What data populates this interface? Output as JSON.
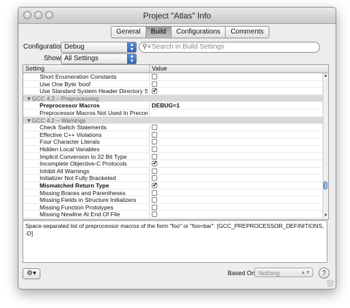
{
  "window": {
    "title": "Project \"Atlas\" Info"
  },
  "tabs": [
    {
      "label": "General",
      "active": false
    },
    {
      "label": "Build",
      "active": true
    },
    {
      "label": "Configurations",
      "active": false
    },
    {
      "label": "Comments",
      "active": false
    }
  ],
  "configuration": {
    "label": "Configuration:",
    "value": "Debug"
  },
  "show": {
    "label": "Show:",
    "value": "All Settings"
  },
  "search": {
    "placeholder": "Search in Build Settings",
    "icon": "magnifier-icon"
  },
  "table": {
    "headers": {
      "setting": "Setting",
      "value": "Value"
    },
    "rows": [
      {
        "name": "Short Enumeration Constants",
        "type": "check",
        "checked": false
      },
      {
        "name": "Use One Byte 'bool'",
        "type": "check",
        "checked": false
      },
      {
        "name": "Use Standard System Header Directory Se...",
        "type": "check",
        "checked": true
      },
      {
        "name": "▼GCC 4.2 – Preprocessing",
        "type": "group"
      },
      {
        "name": "Preprocessor Macros",
        "type": "text",
        "value": "DEBUG=1",
        "bold": true
      },
      {
        "name": "Preprocessor Macros Not Used In Precom...",
        "type": "text",
        "value": ""
      },
      {
        "name": "▼GCC 4.2 – Warnings",
        "type": "group"
      },
      {
        "name": "Check Switch Statements",
        "type": "check",
        "checked": false
      },
      {
        "name": "Effective C++ Violations",
        "type": "check",
        "checked": false
      },
      {
        "name": "Four Character Literals",
        "type": "check",
        "checked": false
      },
      {
        "name": "Hidden Local Variables",
        "type": "check",
        "checked": false
      },
      {
        "name": "Implicit Conversion to 32 Bit Type",
        "type": "check",
        "checked": false
      },
      {
        "name": "Incomplete Objective-C Protocols",
        "type": "check",
        "checked": true
      },
      {
        "name": "Inhibit All Warnings",
        "type": "check",
        "checked": false
      },
      {
        "name": "Initializer Not Fully Bracketed",
        "type": "check",
        "checked": false
      },
      {
        "name": "Mismatched Return Type",
        "type": "check",
        "checked": true,
        "bold": true
      },
      {
        "name": "Missing Braces and Parentheses",
        "type": "check",
        "checked": false
      },
      {
        "name": "Missing Fields in Structure Initializers",
        "type": "check",
        "checked": false
      },
      {
        "name": "Missing Function Prototypes",
        "type": "check",
        "checked": false
      },
      {
        "name": "Missing Newline At End Of File",
        "type": "check",
        "checked": false
      }
    ]
  },
  "description": "Space-separated list of preprocessor macros of the form \"foo\" or \"foo=bar\". [GCC_PREPROCESSOR_DEFINITIONS, -D]",
  "footer": {
    "gear_icon": "gear-icon",
    "based_on_label": "Based On:",
    "based_on_value": "Nothing",
    "help_label": "?"
  }
}
